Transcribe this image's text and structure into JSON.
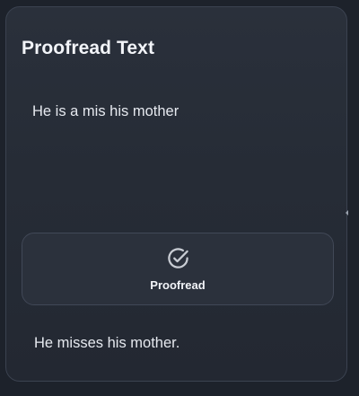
{
  "panel": {
    "title": "Proofread Text",
    "input_text": "He is a mis his mother",
    "button": {
      "label": "Proofread",
      "icon": "check-circle-icon"
    },
    "output_text": "He misses his mother."
  },
  "colors": {
    "background": "#1d222b",
    "panel": "#272d37",
    "border": "#3b4250",
    "text": "#eef1f6",
    "icon": "#c9cdd4"
  }
}
